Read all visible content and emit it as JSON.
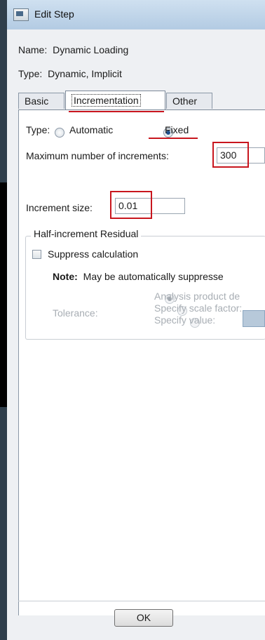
{
  "window": {
    "title": "Edit Step"
  },
  "step": {
    "name_label": "Name:",
    "name_value": "Dynamic Loading",
    "type_label": "Type:",
    "type_value": "Dynamic, Implicit"
  },
  "tabs": [
    {
      "label": "Basic"
    },
    {
      "label": "Incrementation",
      "active": true
    },
    {
      "label": "Other"
    }
  ],
  "incrementation": {
    "type_label": "Type:",
    "type_options": [
      {
        "label": "Automatic",
        "checked": false
      },
      {
        "label": "Fixed",
        "checked": true
      }
    ],
    "max_increments_label": "Maximum number of increments:",
    "max_increments_value": "300",
    "increment_size_label": "Increment size:",
    "increment_size_value": "0.01"
  },
  "half_increment": {
    "title": "Half-increment Residual",
    "suppress_label": "Suppress calculation",
    "note_label": "Note:",
    "note_text": "May be automatically suppresse",
    "tolerance_label": "Tolerance:",
    "tolerance_options": [
      {
        "label": "Analysis product de",
        "checked": true
      },
      {
        "label": "Specify scale factor:",
        "checked": false
      },
      {
        "label": "Specify value:",
        "checked": false
      }
    ]
  },
  "buttons": {
    "ok": "OK"
  },
  "colors": {
    "highlight": "#c8161e",
    "title_bar": "#b3cbe3"
  }
}
